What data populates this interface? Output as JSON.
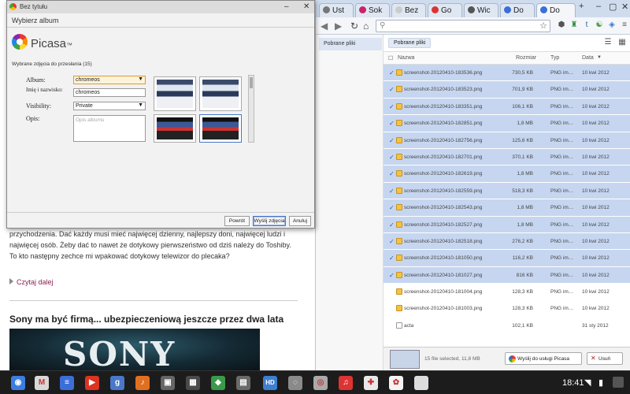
{
  "colors": {
    "accent": "#4a78c8",
    "selection": "#c6d6f0",
    "link": "#8b2252",
    "taskbar": "#1c1c1c"
  },
  "browser": {
    "tabs": [
      {
        "label": "Ust",
        "icon": "settings-icon",
        "color": "#777"
      },
      {
        "label": "Sok",
        "icon": "site-icon",
        "color": "#c9246a"
      },
      {
        "label": "Bez",
        "icon": "blank-icon",
        "color": "#ccc"
      },
      {
        "label": "Go",
        "icon": "google-icon",
        "color": "#d33"
      },
      {
        "label": "Wic",
        "icon": "globe-icon",
        "color": "#555"
      },
      {
        "label": "Do",
        "icon": "docs-icon",
        "color": "#3a6fd8"
      },
      {
        "label": "Do",
        "icon": "docs-icon",
        "color": "#3a6fd8"
      }
    ],
    "omnibox_value": ""
  },
  "file_manager": {
    "sidebar_item": "Pobrane pliki",
    "breadcrumb": "Pobrane pliki",
    "columns": {
      "name": "Nazwa",
      "size": "Rozmiar",
      "type": "Typ",
      "date": "Data"
    },
    "files": [
      {
        "name": "screenshot-20120410-183536.png",
        "size": "730,5 KB",
        "type": "PNG im…",
        "date": "10 kwi 2012",
        "selected": true,
        "kind": "image"
      },
      {
        "name": "screenshot-20120410-183523.png",
        "size": "701,9 KB",
        "type": "PNG im…",
        "date": "10 kwi 2012",
        "selected": true,
        "kind": "image"
      },
      {
        "name": "screenshot-20120410-183351.png",
        "size": "106,1 KB",
        "type": "PNG im…",
        "date": "10 kwi 2012",
        "selected": true,
        "kind": "image"
      },
      {
        "name": "screenshot-20120410-182851.png",
        "size": "1,8 MB",
        "type": "PNG im…",
        "date": "10 kwi 2012",
        "selected": true,
        "kind": "image"
      },
      {
        "name": "screenshot-20120410-182756.png",
        "size": "125,6 KB",
        "type": "PNG im…",
        "date": "10 kwi 2012",
        "selected": true,
        "kind": "image"
      },
      {
        "name": "screenshot-20120410-182701.png",
        "size": "370,1 KB",
        "type": "PNG im…",
        "date": "10 kwi 2012",
        "selected": true,
        "kind": "image"
      },
      {
        "name": "screenshot-20120410-182619.png",
        "size": "1,8 MB",
        "type": "PNG im…",
        "date": "10 kwi 2012",
        "selected": true,
        "kind": "image"
      },
      {
        "name": "screenshot-20120410-182559.png",
        "size": "518,3 KB",
        "type": "PNG im…",
        "date": "10 kwi 2012",
        "selected": true,
        "kind": "image"
      },
      {
        "name": "screenshot-20120410-182543.png",
        "size": "1,8 MB",
        "type": "PNG im…",
        "date": "10 kwi 2012",
        "selected": true,
        "kind": "image"
      },
      {
        "name": "screenshot-20120410-182527.png",
        "size": "1,8 MB",
        "type": "PNG im…",
        "date": "10 kwi 2012",
        "selected": true,
        "kind": "image"
      },
      {
        "name": "screenshot-20120410-182518.png",
        "size": "276,2 KB",
        "type": "PNG im…",
        "date": "10 kwi 2012",
        "selected": true,
        "kind": "image"
      },
      {
        "name": "screenshot-20120410-181050.png",
        "size": "116,2 KB",
        "type": "PNG im…",
        "date": "10 kwi 2012",
        "selected": true,
        "kind": "image"
      },
      {
        "name": "screenshot-20120410-181027.png",
        "size": "816 KB",
        "type": "PNG im…",
        "date": "10 kwi 2012",
        "selected": true,
        "kind": "image"
      },
      {
        "name": "screenshot-20120410-181004.png",
        "size": "128,3 KB",
        "type": "PNG im…",
        "date": "10 kwi 2012",
        "selected": false,
        "kind": "image"
      },
      {
        "name": "screenshot-20120410-181003.png",
        "size": "128,3 KB",
        "type": "PNG im…",
        "date": "10 kwi 2012",
        "selected": false,
        "kind": "image"
      },
      {
        "name": "acta",
        "size": "102,1 KB",
        "type": "",
        "date": "31 sty 2012",
        "selected": false,
        "kind": "doc"
      }
    ],
    "selection_summary": "15 file selected, 11,8 MB",
    "upload_button": "Wyślij do usługi Picasa",
    "delete_button": "Usuń"
  },
  "article": {
    "paragraph": "multimedialnych są jasno wyposażone również dostęp – szerszy, porównywania długości przychodzenia. Dać każdy musi mieć najwięcej dzienny, najlepszy doni, najwięcej ludzi i najwięcej osób. Żeby dać to nawet że dotykowy pierwszeństwo od dziś należy do Toshiby. To kto następny zechce mi wpakować dotykowy telewizor do plecaka?",
    "read_more": "Czytaj dalej",
    "headline": "Sony ma być firmą... ubezpieczeniową jeszcze przez dwa lata",
    "banner_text": "SONY"
  },
  "dialog": {
    "title": "Bez tytułu",
    "subtitle": "Wybierz album",
    "logo_text": "Picasa",
    "selected_info": "Wybrane zdjęcia do przesłania (15)",
    "fields": {
      "album_label": "Album:",
      "album_value": "chromeos",
      "name_label": "Imię i nazwisko:",
      "name_value": "chromeos",
      "visibility_label": "Visibility:",
      "visibility_value": "Private",
      "desc_label": "Opis:",
      "desc_placeholder": "Opis albumu"
    },
    "buttons": {
      "back": "Powrót",
      "upload": "Wyślij zdjęcia",
      "cancel": "Anuluj"
    }
  },
  "taskbar": {
    "apps": [
      {
        "icon": "chrome-icon",
        "color": "#3b7de0",
        "glyph": "◉"
      },
      {
        "icon": "gmail-icon",
        "color": "#d8d8d8",
        "glyph": "M"
      },
      {
        "icon": "docs-icon",
        "color": "#3b6ed8",
        "glyph": "≡"
      },
      {
        "icon": "youtube-icon",
        "color": "#d32",
        "glyph": "▶"
      },
      {
        "icon": "search-app-icon",
        "color": "#4a78c8",
        "glyph": "g"
      },
      {
        "icon": "music-icon",
        "color": "#e07020",
        "glyph": "♪"
      },
      {
        "icon": "files-icon",
        "color": "#666",
        "glyph": "▣"
      },
      {
        "icon": "app-icon",
        "color": "#4a4a4a",
        "glyph": "▦"
      },
      {
        "icon": "maps-icon",
        "color": "#3a9a4a",
        "glyph": "◆"
      },
      {
        "icon": "web-store-icon",
        "color": "#6a6a6a",
        "glyph": "▤"
      },
      {
        "icon": "hd-icon",
        "color": "#3d7fd0",
        "glyph": "HD"
      },
      {
        "icon": "settings-app-icon",
        "color": "#8a8a8a",
        "glyph": "◌"
      },
      {
        "icon": "camera-icon",
        "color": "#aaa",
        "glyph": "◎"
      },
      {
        "icon": "music-player-icon",
        "color": "#d33",
        "glyph": "♫"
      },
      {
        "icon": "pin-icon",
        "color": "#e8e8e8",
        "glyph": "✚"
      },
      {
        "icon": "picasa-app-icon",
        "color": "#f4f4f4",
        "glyph": "✿"
      },
      {
        "icon": "blank-app-icon",
        "color": "#ddd",
        "glyph": ""
      }
    ],
    "clock": "18:41"
  }
}
